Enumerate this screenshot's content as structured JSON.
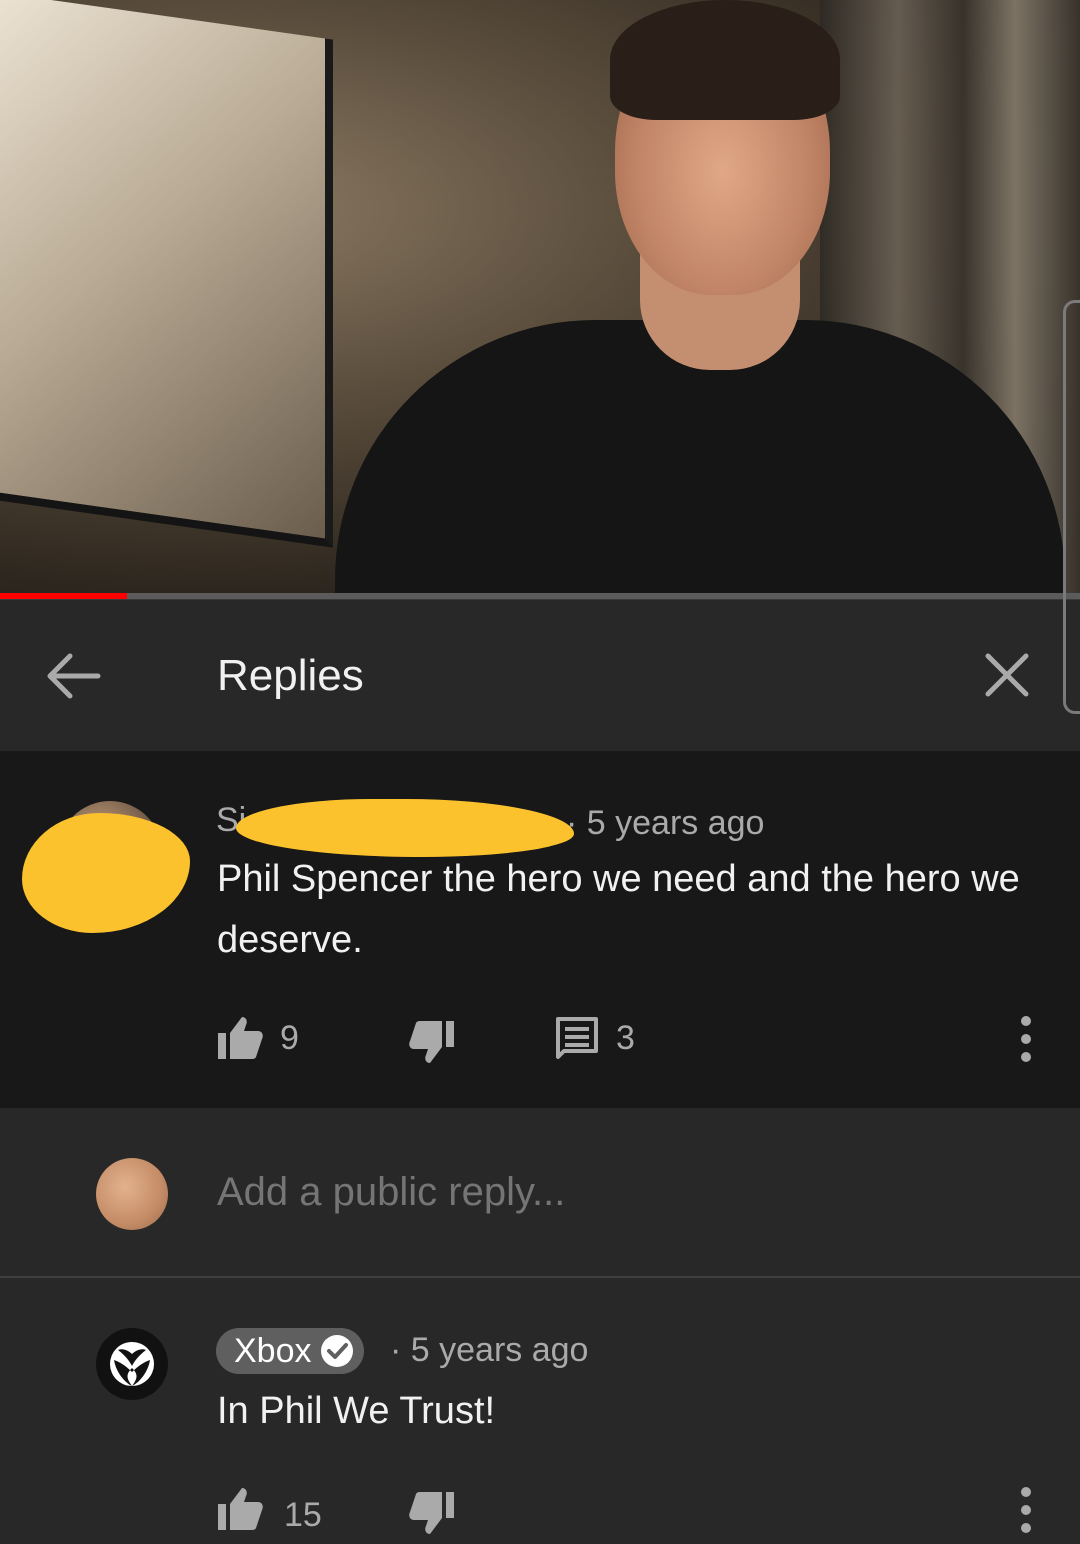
{
  "video": {
    "progress_percent": 11.8,
    "progress_color": "#ff0000"
  },
  "header": {
    "title": "Replies",
    "back_icon": "arrow-left-icon",
    "close_icon": "close-icon"
  },
  "parent_comment": {
    "author_visible": "Si",
    "separator": "·",
    "time": "5 years ago",
    "text": "Phil Spencer the hero we need and the hero we deserve.",
    "likes": "9",
    "replies": "3",
    "redaction_color": "#fcc22d"
  },
  "add_reply": {
    "placeholder": "Add a public reply..."
  },
  "reply_comment": {
    "author": "Xbox",
    "verified": true,
    "separator": "·",
    "time": "5 years ago",
    "text": "In Phil We Trust!",
    "likes": "15"
  }
}
